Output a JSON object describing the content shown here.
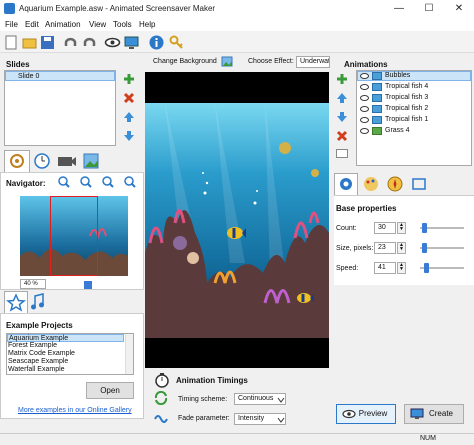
{
  "window": {
    "title": "Aquarium Example.asw - Animated Screensaver Maker",
    "minimize": "—",
    "maximize": "☐",
    "close": "✕"
  },
  "menu": [
    "File",
    "Edit",
    "Animation",
    "View",
    "Tools",
    "Help"
  ],
  "slides": {
    "title": "Slides",
    "items": [
      "Slide 0"
    ]
  },
  "center": {
    "change_background": "Change Background",
    "choose_effect_label": "Choose Effect:",
    "effect_value": "Underwat"
  },
  "navigator": {
    "title": "Navigator:",
    "zoom_value": "40 %"
  },
  "example_projects": {
    "title": "Example Projects",
    "items": [
      "Aquarium Example",
      "Forest Example",
      "Matrix Code Example",
      "Seascape Example",
      "Waterfall Example"
    ],
    "open_button": "Open",
    "gallery_link": "More examples in our Online Gallery"
  },
  "animations": {
    "title": "Animations",
    "items": [
      "Bubbles",
      "Tropical fish 4",
      "Tropical fish 3",
      "Tropical fish 2",
      "Tropical fish 1",
      "Grass 4"
    ]
  },
  "base_properties": {
    "title": "Base properties",
    "count_label": "Count:",
    "count_value": "30",
    "size_label": "Size, pixels:",
    "size_value": "23",
    "speed_label": "Speed:",
    "speed_value": "41",
    "count_level": 0.05,
    "size_level": 0.05,
    "speed_level": 0.1
  },
  "timings": {
    "title": "Animation Timings",
    "timing_label": "Timing scheme:",
    "timing_value": "Continuous",
    "fade_label": "Fade parameter:",
    "fade_value": "Intensity"
  },
  "buttons": {
    "preview": "Preview",
    "create": "Create"
  },
  "status": {
    "num": "NUM"
  },
  "colors": {
    "accent": "#2b78c9",
    "selection": "#cce4f7",
    "water": "#1d7aa8"
  }
}
